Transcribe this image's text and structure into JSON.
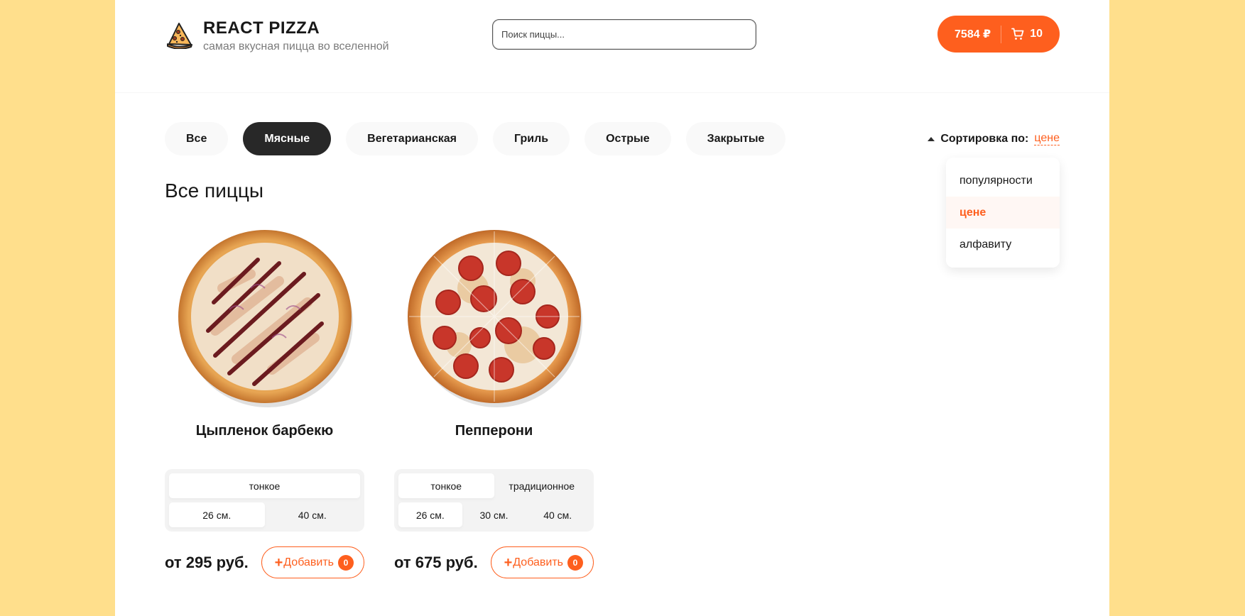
{
  "header": {
    "title": "REACT PIZZA",
    "subtitle": "самая вкусная пицца во вселенной",
    "search_placeholder": "Поиск пиццы...",
    "cart_total": "7584 ₽",
    "cart_count": "10"
  },
  "categories": [
    "Все",
    "Мясные",
    "Вегетарианская",
    "Гриль",
    "Острые",
    "Закрытые"
  ],
  "active_category": "Мясные",
  "sort": {
    "label": "Сортировка по:",
    "value": "цене",
    "options": [
      "популярности",
      "цене",
      "алфавиту"
    ]
  },
  "content_title": "Все пиццы",
  "pizzas": [
    {
      "name": "Цыпленок барбекю",
      "types": [
        "тонкое"
      ],
      "active_type": "тонкое",
      "sizes": [
        "26 см.",
        "40 см."
      ],
      "active_size": "26 см.",
      "price": "от 295 руб.",
      "add_label": "Добавить",
      "count": "0"
    },
    {
      "name": "Пепперони",
      "types": [
        "тонкое",
        "традиционное"
      ],
      "active_type": "тонкое",
      "sizes": [
        "26 см.",
        "30 см.",
        "40 см."
      ],
      "active_size": "26 см.",
      "price": "от 675 руб.",
      "add_label": "Добавить",
      "count": "0"
    }
  ],
  "colors": {
    "accent": "#FE5F1E",
    "page_background": "#FFDF8C",
    "active_category": "#282828"
  }
}
